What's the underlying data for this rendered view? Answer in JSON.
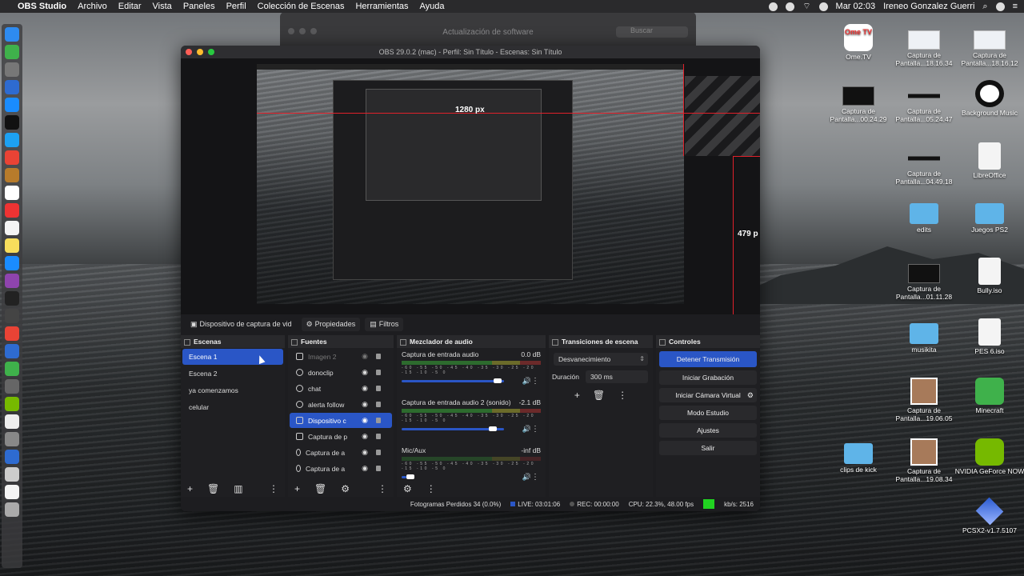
{
  "menubar": {
    "app": "OBS Studio",
    "items": [
      "Archivo",
      "Editar",
      "Vista",
      "Paneles",
      "Perfil",
      "Colección de Escenas",
      "Herramientas",
      "Ayuda"
    ],
    "clock": "Mar 02:03",
    "user": "Ireneo Gonzalez Guerri"
  },
  "update_window": {
    "title": "Actualización de software",
    "search_placeholder": "Buscar"
  },
  "obs": {
    "title": "OBS 29.0.2 (mac) - Perfil: Sin Título - Escenas: Sin Título",
    "preview": {
      "label_width": "1280 px",
      "label_height": "479 p"
    },
    "source_toolbar": {
      "device": "Dispositivo de captura de vid",
      "properties": "Propiedades",
      "filters": "Filtros"
    },
    "scenes": {
      "header": "Escenas",
      "items": [
        "Escena 1",
        "Escena 2",
        "ya comenzamos",
        "celular"
      ]
    },
    "sources": {
      "header": "Fuentes",
      "items": [
        "Imagen 2",
        "donoclip",
        "chat",
        "alerta follow",
        "Dispositivo c",
        "Captura de p",
        "Captura de a",
        "Captura de a"
      ]
    },
    "mixer": {
      "header": "Mezclador de audio",
      "channels": [
        {
          "name": "Captura de entrada audio",
          "db": "0.0 dB",
          "level": 0.9
        },
        {
          "name": "Captura de entrada audio 2 (sonido)",
          "db": "-2.1 dB",
          "level": 0.85
        },
        {
          "name": "Mic/Aux",
          "db": "-inf dB",
          "level": 0.05
        }
      ],
      "ticks": "-60 -55 -50 -45 -40 -35 -30 -25 -20 -15 -10 -5 0"
    },
    "transitions": {
      "header": "Transiciones de escena",
      "selected": "Desvanecimiento",
      "duration_label": "Duración",
      "duration_value": "300 ms"
    },
    "controls": {
      "header": "Controles",
      "buttons": [
        "Detener Transmisión",
        "Iniciar Grabación",
        "Iniciar Cámara Virtual",
        "Modo Estudio",
        "Ajustes",
        "Salir"
      ]
    },
    "status": {
      "dropped": "Fotogramas Perdidos 34 (0.0%)",
      "live": "LIVE: 03:01:06",
      "rec": "REC: 00:00:00",
      "cpu": "CPU: 22.3%, 48.00 fps",
      "kbs": "kb/s: 2516"
    }
  },
  "desktop_icons": [
    {
      "label": "Ome.TV",
      "type": "ome"
    },
    {
      "label": "Captura de Pantalla...18.16.34",
      "type": "shot"
    },
    {
      "label": "Captura de Pantalla...18.16.12",
      "type": "shot"
    },
    {
      "label": "Captura de Pantalla...00.24.29",
      "type": "shotdark"
    },
    {
      "label": "Captura de Pantalla...05.24.47",
      "type": "shotline"
    },
    {
      "label": "Background Music",
      "type": "bgm"
    },
    {
      "label": "Captura de Pantalla...04.49.18",
      "type": "shotline"
    },
    {
      "label": "LibreOffice",
      "type": "doc"
    },
    {
      "label": "edits",
      "type": "folder"
    },
    {
      "label": "Juegos PS2",
      "type": "folder"
    },
    {
      "label": "Captura de Pantalla...01.11.28",
      "type": "shotdark"
    },
    {
      "label": "Bully.iso",
      "type": "doc"
    },
    {
      "label": "musikita",
      "type": "folder"
    },
    {
      "label": "PES 6.iso",
      "type": "doc"
    },
    {
      "label": "Captura de Pantalla...19.06.05",
      "type": "portrait"
    },
    {
      "label": "Minecraft",
      "type": "green"
    },
    {
      "label": "clips de kick",
      "type": "folder"
    },
    {
      "label": "Captura de Pantalla...19.08.34",
      "type": "portrait"
    },
    {
      "label": "NVIDIA GeForce NOW",
      "type": "nvidia"
    },
    {
      "label": "PCSX2-v1.7.5107",
      "type": "pcsx"
    }
  ]
}
